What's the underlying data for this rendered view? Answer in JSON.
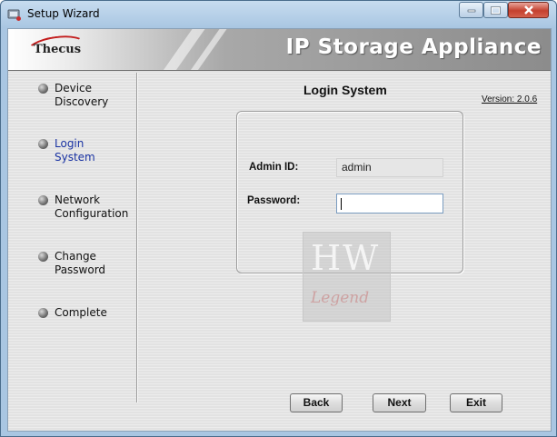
{
  "window": {
    "title": "Setup Wizard"
  },
  "banner": {
    "logo": "Thecus",
    "title": "IP Storage Appliance"
  },
  "steps": [
    {
      "label": "Device\nDiscovery",
      "active": false
    },
    {
      "label": "Login\nSystem",
      "active": true
    },
    {
      "label": "Network\nConfiguration",
      "active": false
    },
    {
      "label": "Change\nPassword",
      "active": false
    },
    {
      "label": "Complete",
      "active": false
    }
  ],
  "main": {
    "title": "Login System",
    "version": "Version: 2.0.6",
    "admin_label": "Admin ID:",
    "admin_value": "admin",
    "password_label": "Password:",
    "password_value": ""
  },
  "watermark": {
    "text": "HW",
    "sub": "Legend"
  },
  "buttons": {
    "back": "Back",
    "next": "Next",
    "exit": "Exit"
  },
  "colors": {
    "active_step": "#1a33a3",
    "close_button": "#c4402e"
  }
}
